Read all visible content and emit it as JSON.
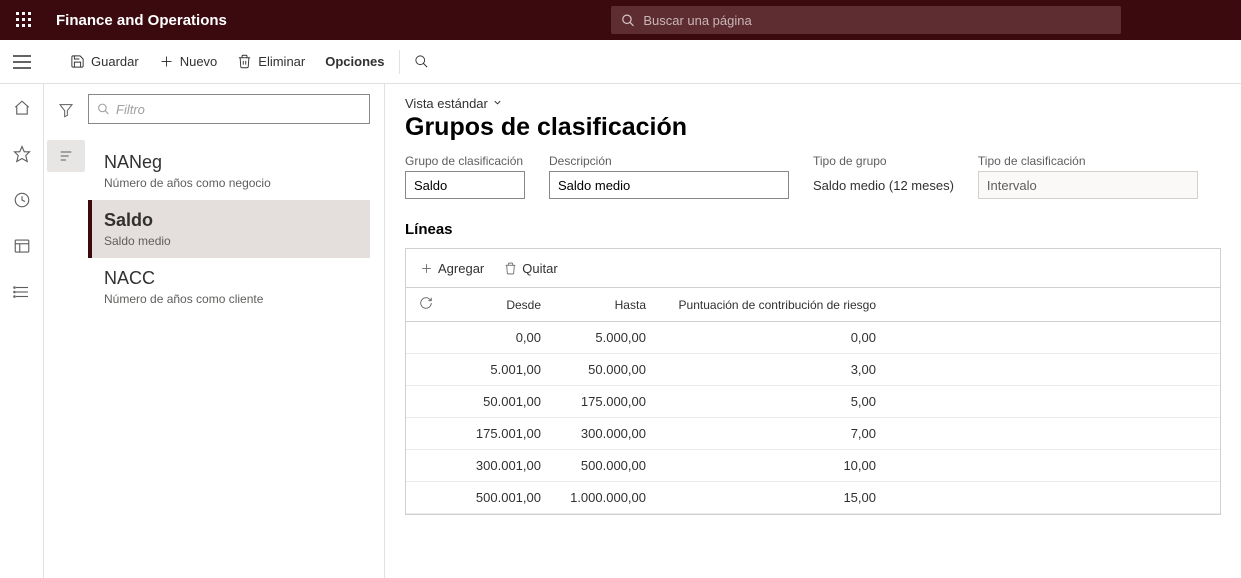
{
  "header": {
    "app_title": "Finance and Operations",
    "search_placeholder": "Buscar una página"
  },
  "actions": {
    "save": "Guardar",
    "new": "Nuevo",
    "delete": "Eliminar",
    "options": "Opciones"
  },
  "leftpanel": {
    "filter_placeholder": "Filtro",
    "items": [
      {
        "title": "NANeg",
        "sub": "Número de años como negocio"
      },
      {
        "title": "Saldo",
        "sub": "Saldo medio"
      },
      {
        "title": "NACC",
        "sub": "Número de años como cliente"
      }
    ],
    "selected_index": 1
  },
  "content": {
    "view_label": "Vista estándar",
    "page_title": "Grupos de clasificación",
    "fields": {
      "group_label": "Grupo de clasificación",
      "group_value": "Saldo",
      "desc_label": "Descripción",
      "desc_value": "Saldo medio",
      "type_label": "Tipo de grupo",
      "type_value": "Saldo medio (12 meses)",
      "class_label": "Tipo de clasificación",
      "class_value": "Intervalo"
    },
    "lines": {
      "title": "Líneas",
      "add": "Agregar",
      "remove": "Quitar",
      "columns": {
        "from": "Desde",
        "to": "Hasta",
        "score": "Puntuación de contribución de riesgo"
      },
      "rows": [
        {
          "from": "0,00",
          "to": "5.000,00",
          "score": "0,00"
        },
        {
          "from": "5.001,00",
          "to": "50.000,00",
          "score": "3,00"
        },
        {
          "from": "50.001,00",
          "to": "175.000,00",
          "score": "5,00"
        },
        {
          "from": "175.001,00",
          "to": "300.000,00",
          "score": "7,00"
        },
        {
          "from": "300.001,00",
          "to": "500.000,00",
          "score": "10,00"
        },
        {
          "from": "500.001,00",
          "to": "1.000.000,00",
          "score": "15,00"
        }
      ]
    }
  }
}
